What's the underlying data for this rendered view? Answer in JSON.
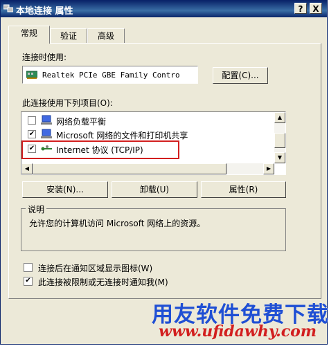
{
  "window": {
    "title": "本地连接 属性",
    "help_button": "?",
    "close_button": "X"
  },
  "tabs": [
    {
      "label": "常规",
      "active": true
    },
    {
      "label": "验证",
      "active": false
    },
    {
      "label": "高级",
      "active": false
    }
  ],
  "general": {
    "connect_using_label": "连接时使用:",
    "adapter_name": "Realtek PCIe GBE Family Contro",
    "configure_button": "配置(C)...",
    "items_label": "此连接使用下列项目(O):",
    "items": [
      {
        "label": "网络负载平衡",
        "checked": false,
        "icon": "network-service-icon"
      },
      {
        "label": "Microsoft 网络的文件和打印机共享",
        "checked": true,
        "icon": "network-service-icon"
      },
      {
        "label": "Internet 协议 (TCP/IP)",
        "checked": true,
        "icon": "protocol-icon",
        "highlighted": true
      }
    ],
    "install_button": "安装(N)...",
    "uninstall_button": "卸载(U)",
    "properties_button": "属性(R)",
    "description_group_label": "说明",
    "description_text": "允许您的计算机访问 Microsoft 网络上的资源。",
    "show_icon_label": "连接后在通知区域显示图标(W)",
    "show_icon_checked": false,
    "notify_limited_label": "此连接被限制或无连接时通知我(M)",
    "notify_limited_checked": true
  },
  "watermark": {
    "brand": "用友软件免费下载",
    "url": "www.ufidawhy.com"
  },
  "colors": {
    "title_bar": "#0a246a",
    "highlight_box": "#d21f1f",
    "watermark_blue": "#1f4fd4",
    "watermark_red": "#d21f1f"
  }
}
